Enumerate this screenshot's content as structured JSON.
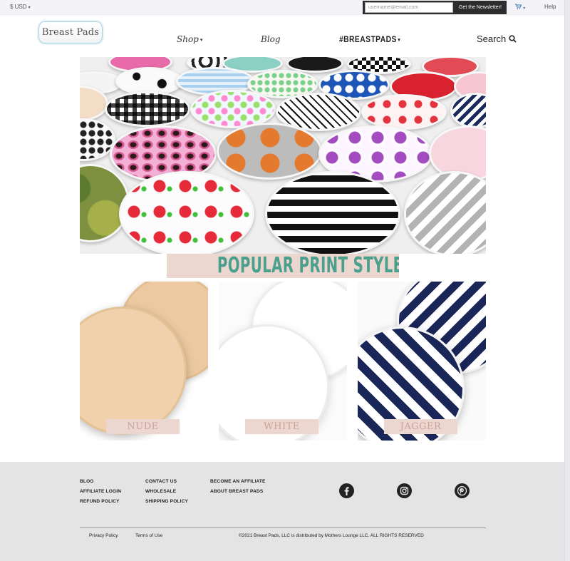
{
  "topbar": {
    "currency": "$ USD",
    "newsletter_placeholder": "username@email.com",
    "newsletter_button": "Get the Newsletter!",
    "help": "Help"
  },
  "logo": {
    "text": "Breast Pads"
  },
  "nav": {
    "shop": "Shop",
    "blog": "Blog",
    "hashtag": "#BREASTPADS",
    "search": "Search"
  },
  "hero": {
    "banner": "POPULAR PRINT STYLES"
  },
  "products": [
    {
      "label": "NUDE"
    },
    {
      "label": "WHITE"
    },
    {
      "label": "JAGGER"
    }
  ],
  "footer": {
    "col1": [
      "BLOG",
      "AFFILIATE LOGIN",
      "REFUND POLICY"
    ],
    "col2": [
      "CONTACT US",
      "WHOLESALE",
      "SHIPPING POLICY"
    ],
    "col3": [
      "BECOME AN AFFILIATE",
      "ABOUT BREAST PADS"
    ],
    "social": [
      "facebook-icon",
      "instagram-icon",
      "pinterest-icon"
    ],
    "privacy": "Privacy Policy",
    "terms": "Terms of Use",
    "copyright": "©2021 Breast Pads, LLC is distributed by Mothers Lounge LLC. ALL RIGHTS RESERVED"
  },
  "colors": {
    "banner_bg": "#ecd6d0",
    "banner_text": "#4aa08d",
    "tile_label_text": "#c9a39a",
    "footer_bg": "#e4e4e4",
    "newsletter_bg": "#2d2d2d"
  }
}
